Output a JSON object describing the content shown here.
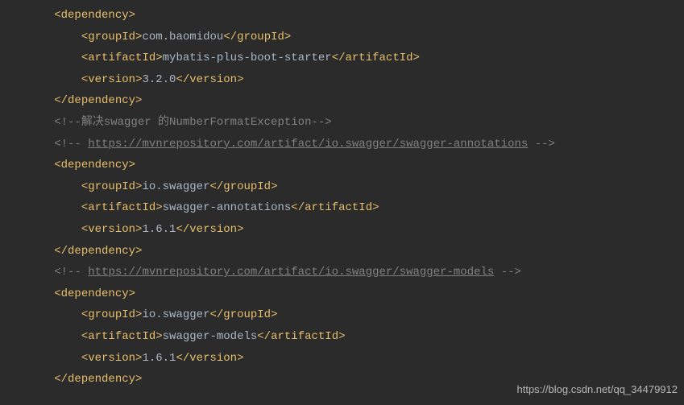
{
  "dep1": {
    "open": "<dependency>",
    "groupOpen": "<groupId>",
    "groupVal": "com.baomidou",
    "groupClose": "</groupId>",
    "artifactOpen": "<artifactId>",
    "artifactVal": "mybatis-plus-boot-starter",
    "artifactClose": "</artifactId>",
    "versionOpen": "<version>",
    "versionVal": "3.2.0",
    "versionClose": "</version>",
    "close": "</dependency>"
  },
  "comment1": {
    "open": "<!--",
    "text": "解决swagger 的NumberFormatException",
    "close": "-->"
  },
  "comment2": {
    "open": "<!-- ",
    "link": "https://mvnrepository.com/artifact/io.swagger/swagger-annotations",
    "close": " -->"
  },
  "dep2": {
    "open": "<dependency>",
    "groupOpen": "<groupId>",
    "groupVal": "io.swagger",
    "groupClose": "</groupId>",
    "artifactOpen": "<artifactId>",
    "artifactVal": "swagger-annotations",
    "artifactClose": "</artifactId>",
    "versionOpen": "<version>",
    "versionVal": "1.6.1",
    "versionClose": "</version>",
    "close": "</dependency>"
  },
  "comment3": {
    "open": "<!-- ",
    "link": "https://mvnrepository.com/artifact/io.swagger/swagger-models",
    "close": " -->"
  },
  "dep3": {
    "open": "<dependency>",
    "groupOpen": "<groupId>",
    "groupVal": "io.swagger",
    "groupClose": "</groupId>",
    "artifactOpen": "<artifactId>",
    "artifactVal": "swagger-models",
    "artifactClose": "</artifactId>",
    "versionOpen": "<version>",
    "versionVal": "1.6.1",
    "versionClose": "</version>",
    "close": "</dependency>"
  },
  "watermark": "https://blog.csdn.net/qq_34479912",
  "indent1": "        ",
  "indent2": "            "
}
